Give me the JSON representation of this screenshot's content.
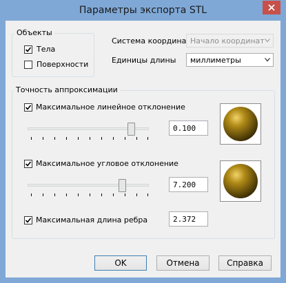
{
  "window": {
    "title": "Параметры экспорта STL",
    "close_label": "×"
  },
  "objects": {
    "group_label": "Объекты",
    "bodies": {
      "label": "Тела",
      "checked": true
    },
    "surfaces": {
      "label": "Поверхности",
      "checked": false
    }
  },
  "coordinate_system": {
    "label": "Система координат",
    "value": "Начало координат"
  },
  "length_units": {
    "label": "Единицы длины",
    "value": "миллиметры"
  },
  "accuracy": {
    "group_label": "Точность аппроксимации",
    "max_linear": {
      "label": "Максимальное линейное отклонение",
      "checked": true,
      "value": "0.100",
      "slider_level": 0.88
    },
    "max_angular": {
      "label": "Максимальное угловое отклонение",
      "checked": true,
      "value": "7.200",
      "slider_level": 0.8
    },
    "max_edge": {
      "label": "Максимальная длина ребра",
      "checked": true,
      "value": "2.372"
    }
  },
  "buttons": {
    "ok": "OK",
    "cancel": "Отмена",
    "help": "Справка"
  },
  "colors": {
    "titlebar": "#7fa8d6",
    "close": "#c7504a",
    "sphere": "#b08a17"
  }
}
